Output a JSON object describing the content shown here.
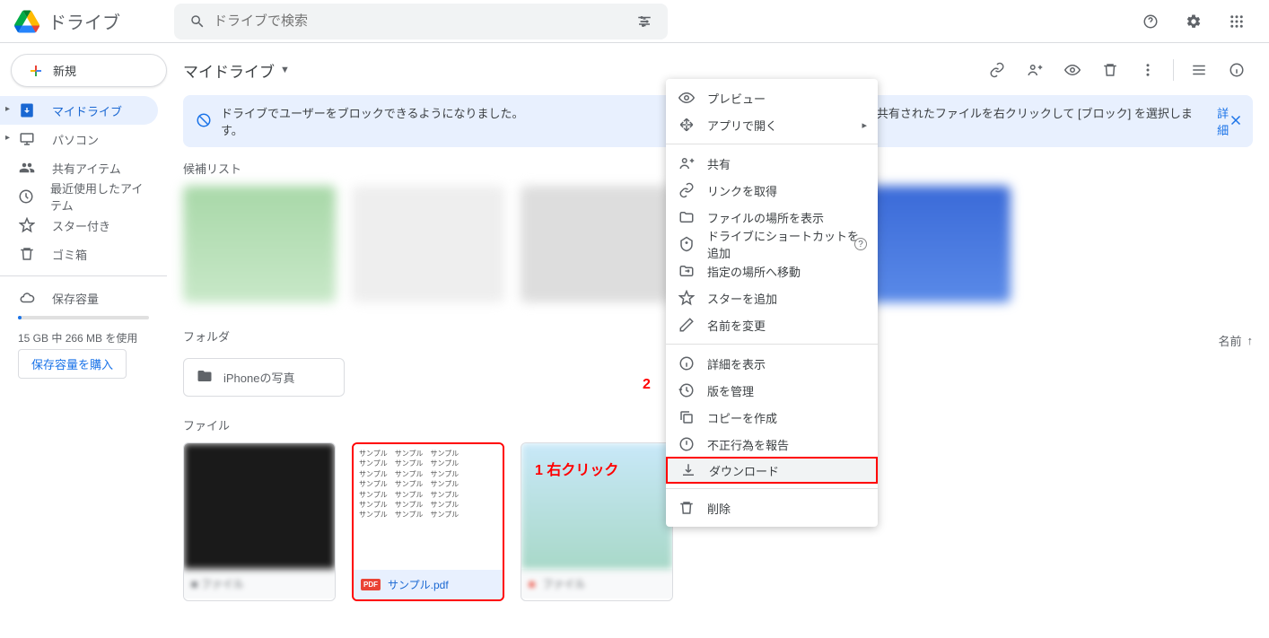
{
  "header": {
    "app_title": "ドライブ",
    "search_placeholder": "ドライブで検索"
  },
  "sidebar": {
    "new_button": "新規",
    "items": [
      {
        "label": "マイドライブ"
      },
      {
        "label": "パソコン"
      },
      {
        "label": "共有アイテム"
      },
      {
        "label": "最近使用したアイテム"
      },
      {
        "label": "スター付き"
      },
      {
        "label": "ゴミ箱"
      }
    ],
    "storage_label": "保存容量",
    "storage_usage": "15 GB 中 266 MB を使用",
    "buy_storage": "保存容量を購入"
  },
  "main": {
    "breadcrumb": "マイドライブ",
    "banner_text_1": "ドライブでユーザーをブロックできるようになりました。",
    "banner_text_2": "ようにするには、共有されたファイルを右クリックして [ブロック] を選択します。",
    "banner_link": "詳細",
    "suggested_label": "候補リスト",
    "folders_label": "フォルダ",
    "sort_label": "名前",
    "folder_name": "iPhoneの写真",
    "files_label": "ファイル",
    "selected_file": "サンプル.pdf",
    "pdf_sample_text": "サンプル"
  },
  "context_menu": {
    "preview": "プレビュー",
    "open_with": "アプリで開く",
    "share": "共有",
    "get_link": "リンクを取得",
    "show_location": "ファイルの場所を表示",
    "add_shortcut": "ドライブにショートカットを追加",
    "move_to": "指定の場所へ移動",
    "add_star": "スターを追加",
    "rename": "名前を変更",
    "details": "詳細を表示",
    "versions": "版を管理",
    "copy": "コピーを作成",
    "report": "不正行為を報告",
    "download": "ダウンロード",
    "delete": "削除"
  },
  "annotations": {
    "a1": "1 右クリック",
    "a2": "2"
  }
}
